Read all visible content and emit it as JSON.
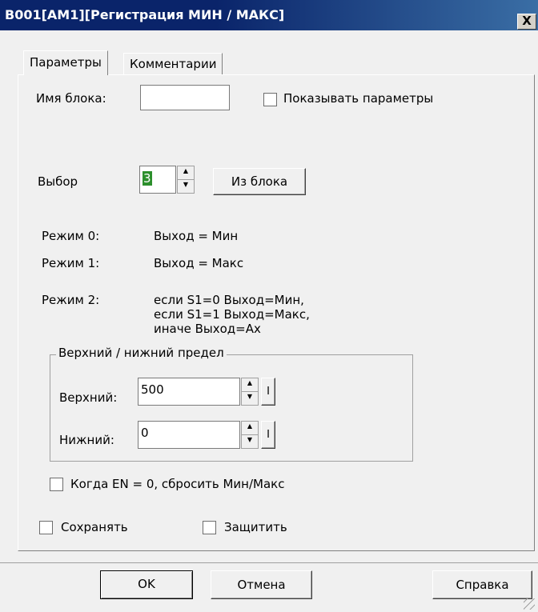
{
  "window": {
    "title": "B001[AM1][Регистрация МИН / МАКС]",
    "close_symbol": "X"
  },
  "tabs": [
    {
      "label": "Параметры",
      "active": true
    },
    {
      "label": "Комментарии",
      "active": false
    }
  ],
  "params": {
    "block_name_label": "Имя блока:",
    "block_name_value": "",
    "show_params_label": "Показывать параметры",
    "select_label": "Выбор",
    "select_value": "3",
    "from_block_label": "Из блока"
  },
  "modes": [
    {
      "label": "Режим 0:",
      "text": "Выход = Мин"
    },
    {
      "label": "Режим 1:",
      "text": "Выход = Макс"
    },
    {
      "label": "Режим 2:",
      "text": "если S1=0 Выход=Мин,",
      "text2": "если S1=1 Выход=Макс,",
      "text3": "иначе Выход=Ax"
    }
  ],
  "limits": {
    "group_label": "Верхний / нижний предел",
    "upper_label": "Верхний:",
    "upper_value": "500",
    "lower_label": "Нижний:",
    "lower_value": "0",
    "ref_button_label": "I"
  },
  "options": {
    "reset_label": "Когда EN = 0, сбросить Мин/Макс",
    "retain_label": "Сохранять",
    "protect_label": "Защитить"
  },
  "footer": {
    "ok_label": "OK",
    "cancel_label": "Отмена",
    "help_label": "Справка"
  },
  "icons": {
    "spin_up": "▲",
    "spin_down": "▼"
  }
}
